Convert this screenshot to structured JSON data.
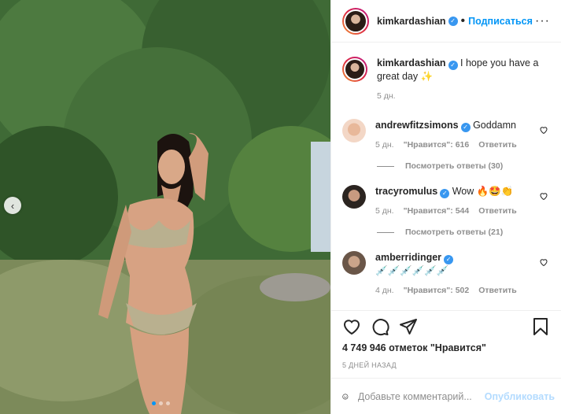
{
  "post": {
    "author": "kimkardashian",
    "follow_label": "Подписаться",
    "separator": "•",
    "more_label": "···"
  },
  "caption": {
    "author": "kimkardashian",
    "text": "I hope you have a great day ✨",
    "time": "5 дн."
  },
  "comments": [
    {
      "user": "andrewfitzsimons",
      "text": "Goddamn",
      "time": "5 дн.",
      "likes": "\"Нравится\": 616",
      "reply": "Ответить",
      "view_replies": "Посмотреть ответы (30)"
    },
    {
      "user": "tracyromulus",
      "text": "Wow 🔥🤩👏",
      "time": "5 дн.",
      "likes": "\"Нравится\": 544",
      "reply": "Ответить",
      "view_replies": "Посмотреть ответы (21)"
    },
    {
      "user": "amberridinger",
      "text": "💉💉💉💉💉💉",
      "time": "4 дн.",
      "likes": "\"Нравится\": 502",
      "reply": "Ответить"
    }
  ],
  "likes_count": "4 749 946 отметок \"Нравится\"",
  "posted_ago": "5 ДНЕЙ НАЗАД",
  "comment_box": {
    "placeholder": "Добавьте комментарий...",
    "publish_label": "Опубликовать"
  },
  "carousel": {
    "total": 3,
    "active": 1
  },
  "icons": [
    "chevron-left-icon",
    "more-icon",
    "verified-badge-icon",
    "heart-icon",
    "comment-icon",
    "share-icon",
    "bookmark-icon",
    "emoji-icon"
  ],
  "colors": {
    "accent": "#0095f6",
    "verified": "#3897f0",
    "muted": "#8e8e8e",
    "publish_disabled": "#b3dbff"
  }
}
